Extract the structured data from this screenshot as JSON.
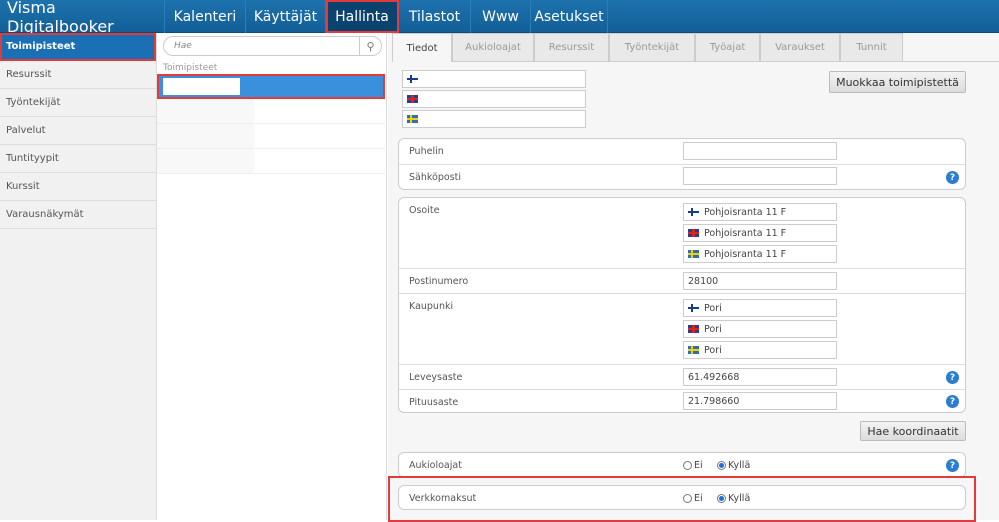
{
  "app_title": "Visma Digitalbooker",
  "nav": [
    {
      "label": "Kalenteri"
    },
    {
      "label": "Käyttäjät"
    },
    {
      "label": "Hallinta",
      "selected": true
    },
    {
      "label": "Tilastot"
    },
    {
      "label": "Www"
    },
    {
      "label": "Asetukset"
    }
  ],
  "sidebar": {
    "items": [
      {
        "label": "Toimipisteet",
        "selected": true
      },
      {
        "label": "Resurssit"
      },
      {
        "label": "Työntekijät"
      },
      {
        "label": "Palvelut"
      },
      {
        "label": "Tuntityypit"
      },
      {
        "label": "Kurssit"
      },
      {
        "label": "Varausnäkymät"
      }
    ]
  },
  "list": {
    "search_placeholder": "Hae",
    "header": "Toimipisteet"
  },
  "tabs": [
    {
      "label": "Tiedot",
      "selected": true
    },
    {
      "label": "Aukioloajat"
    },
    {
      "label": "Resurssit"
    },
    {
      "label": "Työntekijät"
    },
    {
      "label": "Työajat"
    },
    {
      "label": "Varaukset"
    },
    {
      "label": "Tunnit"
    }
  ],
  "details": {
    "edit_button": "Muokkaa toimipistettä",
    "phone_label": "Puhelin",
    "email_label": "Sähköposti",
    "address_label": "Osoite",
    "address": {
      "fi": "Pohjoisranta 11 F",
      "en": "Pohjoisranta 11 F",
      "sv": "Pohjoisranta 11 F"
    },
    "postal_label": "Postinumero",
    "postal": "28100",
    "city_label": "Kaupunki",
    "city": {
      "fi": "Pori",
      "en": "Pori",
      "sv": "Pori"
    },
    "lat_label": "Leveysaste",
    "lat": "61.492668",
    "lon_label": "Pituusaste",
    "lon": "21.798660",
    "coords_button": "Hae koordinaatit",
    "opening_label": "Aukioloajat",
    "online_pay_label": "Verkkomaksut",
    "no": "Ei",
    "yes": "Kyllä",
    "opening_value": "Kyllä",
    "online_pay_value": "Kyllä"
  },
  "colors": {
    "nav": "#1d72ad",
    "selected": "#1a6fb5",
    "highlight": "#e23b3b"
  }
}
